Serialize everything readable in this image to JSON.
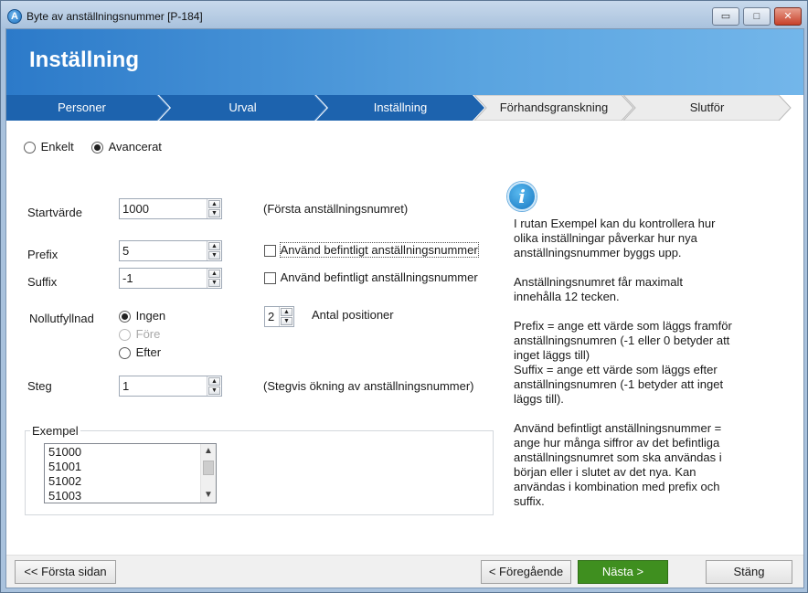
{
  "window": {
    "title": "Byte av anställningsnummer [P-184]",
    "app_icon_glyph": "A",
    "controls": {
      "minimize": "▭",
      "maximize": "□",
      "close": "✕"
    }
  },
  "header": {
    "title": "Inställning"
  },
  "steps": [
    {
      "label": "Personer",
      "state": "done"
    },
    {
      "label": "Urval",
      "state": "done"
    },
    {
      "label": "Inställning",
      "state": "active"
    },
    {
      "label": "Förhandsgranskning",
      "state": "todo"
    },
    {
      "label": "Slutför",
      "state": "todo"
    }
  ],
  "mode": {
    "simple_label": "Enkelt",
    "advanced_label": "Avancerat",
    "selected": "advanced"
  },
  "form": {
    "start": {
      "label": "Startvärde",
      "value": "1000",
      "hint": "(Första anställningsnumret)"
    },
    "prefix": {
      "label": "Prefix",
      "value": "5",
      "checkbox_label": "Använd befintligt anställningsnummer",
      "checked": false
    },
    "suffix": {
      "label": "Suffix",
      "value": "-1",
      "checkbox_label": "Använd befintligt anställningsnummer",
      "checked": false
    },
    "zero_fill": {
      "label": "Nollutfyllnad",
      "options": {
        "none": "Ingen",
        "before": "Före",
        "after": "Efter"
      },
      "selected": "none",
      "positions_value": "2",
      "positions_label": "Antal positioner"
    },
    "step": {
      "label": "Steg",
      "value": "1",
      "hint": "(Stegvis ökning av anställningsnummer)"
    }
  },
  "example": {
    "legend": "Exempel",
    "items": [
      "51000",
      "51001",
      "51002",
      "51003"
    ]
  },
  "info": {
    "icon": "info-icon",
    "text": "I rutan Exempel kan du kontrollera hur olika inställningar påverkar hur nya anställningsnummer byggs upp.\n\nAnställningsnumret får maximalt innehålla 12 tecken.\n\nPrefix = ange ett värde som läggs framför anställningsnumren (-1 eller 0 betyder att inget läggs till)\nSuffix = ange ett värde som läggs efter anställningsnumren (-1 betyder att inget läggs till).\n\nAnvänd befintligt anställningsnummer = ange hur många siffror av det befintliga anställningsnumret som ska användas i början eller i slutet av det nya. Kan användas i kombination med prefix och suffix."
  },
  "footer": {
    "first_page": "<< Första sidan",
    "previous": "< Föregående",
    "next": "Nästa >",
    "close": "Stäng"
  },
  "colors": {
    "step_done": "#1d63ae",
    "step_active": "#1d63ae",
    "step_todo": "#e9e9e9",
    "next_button": "#3f8f1f"
  }
}
